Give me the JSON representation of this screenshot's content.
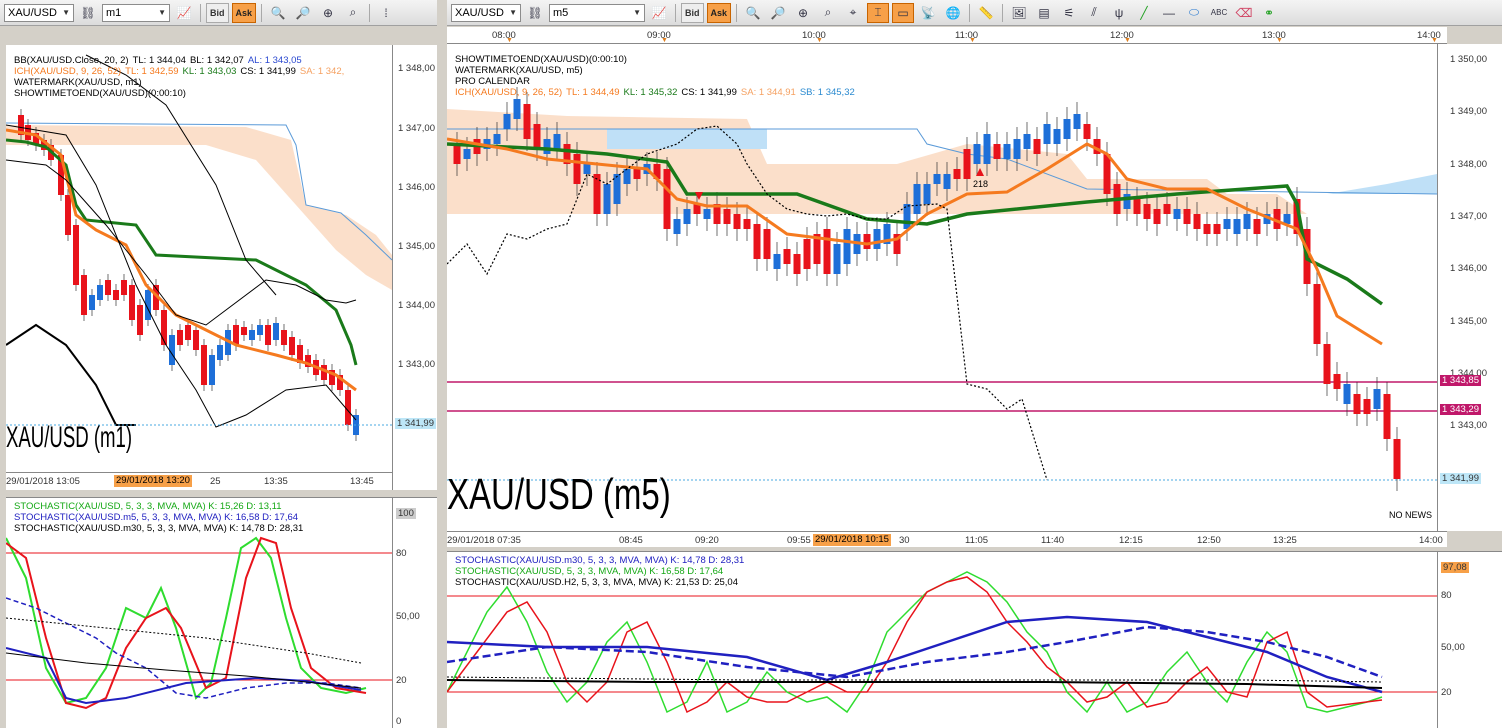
{
  "left": {
    "toolbar": {
      "symbol": "XAU/USD",
      "timeframe": "m1",
      "bid": "Bid",
      "ask": "Ask"
    },
    "legend": [
      {
        "parts": [
          [
            "BB(XAU/USD.Close, 20, 2)",
            "#000"
          ],
          [
            "TL: 1 344,04",
            "#000"
          ],
          [
            "BL: 1 342,07",
            "#000"
          ],
          [
            "AL: 1 343,05",
            "#2a48d0"
          ]
        ]
      },
      {
        "parts": [
          [
            "ICH(XAU/USD, 9, 26, 52)",
            "#f57a1f"
          ],
          [
            "TL: 1 342,59",
            "#f57a1f"
          ],
          [
            "KL: 1 343,03",
            "#1a7a1a"
          ],
          [
            "CS: 1 341,99",
            "#000"
          ],
          [
            "SA: 1 342,",
            "#f5a060"
          ]
        ]
      },
      {
        "parts": [
          [
            "WATERMARK(XAU/USD, m1)",
            "#000"
          ]
        ]
      },
      {
        "parts": [
          [
            "SHOWTIMETOEND(XAU/USD)(0:00:10)",
            "#000"
          ]
        ]
      }
    ],
    "price_ticks": [
      "1 348,00",
      "1 347,00",
      "1 346,00",
      "1 345,00",
      "1 344,00",
      "1 343,00",
      "1 342,00"
    ],
    "current_price": "1 341,99",
    "watermark": "XAU/USD (m1)",
    "time_labels": [
      "29/01/2018 13:05",
      "25",
      "13:35",
      "13:45"
    ],
    "time_highlight": "29/01/2018 13:20",
    "stoch_legend": [
      [
        "STOCHASTIC(XAU/USD, 5, 3, 3, MVA, MVA)  K: 15,26  D: 13,11",
        "#15a815"
      ],
      [
        "STOCHASTIC(XAU/USD.m5, 5, 3, 3, MVA, MVA)  K: 16,58  D: 17,64",
        "#2020c0"
      ],
      [
        "STOCHASTIC(XAU/USD.m30, 5, 3, 3, MVA, MVA)  K: 14,78  D: 28,31",
        "#000"
      ]
    ],
    "stoch_ticks": [
      "100",
      "80",
      "50,00",
      "20",
      "0"
    ]
  },
  "right": {
    "toolbar": {
      "symbol": "XAU/USD",
      "timeframe": "m5",
      "bid": "Bid",
      "ask": "Ask"
    },
    "top_times": [
      "08:00",
      "09:00",
      "10:00",
      "11:00",
      "12:00",
      "13:00",
      "14:00"
    ],
    "legend": [
      {
        "parts": [
          [
            "SHOWTIMETOEND(XAU/USD)(0:00:10)",
            "#000"
          ]
        ]
      },
      {
        "parts": [
          [
            "WATERMARK(XAU/USD, m5)",
            "#000"
          ]
        ]
      },
      {
        "parts": [
          [
            "PRO CALENDAR",
            "#000"
          ]
        ]
      },
      {
        "parts": [
          [
            "ICH(XAU/USD, 9, 26, 52)",
            "#f57a1f"
          ],
          [
            "TL: 1 344,49",
            "#f57a1f"
          ],
          [
            "KL: 1 345,32",
            "#1a7a1a"
          ],
          [
            "CS: 1 341,99",
            "#000"
          ],
          [
            "SA: 1 344,91",
            "#f5a060"
          ],
          [
            "SB: 1 345,32",
            "#2a8ad0"
          ]
        ]
      }
    ],
    "price_ticks": [
      "1 350,00",
      "1 349,00",
      "1 348,00",
      "1 347,00",
      "1 346,00",
      "1 345,00",
      "1 344,00",
      "1 343,00"
    ],
    "marker_prices": [
      "1 343,85",
      "1 343,29"
    ],
    "current_price": "1 341,99",
    "watermark": "XAU/USD (m5)",
    "no_news": "NO NEWS",
    "event_label": "218",
    "time_labels": [
      "29/01/2018 07:35",
      "08:45",
      "09:20",
      "09:55",
      "30",
      "11:05",
      "11:40",
      "12:15",
      "12:50",
      "13:25",
      "14:00"
    ],
    "time_highlight": "29/01/2018 10:15",
    "stoch_legend": [
      [
        "STOCHASTIC(XAU/USD.m30, 5, 3, 3, MVA, MVA)  K: 14,78  D: 28,31",
        "#2020c0"
      ],
      [
        "STOCHASTIC(XAU/USD, 5, 3, 3, MVA, MVA)  K: 16,58  D: 17,64",
        "#15a815"
      ],
      [
        "STOCHASTIC(XAU/USD.H2, 5, 3, 3, MVA, MVA)  K: 21,53  D: 25,04",
        "#000"
      ]
    ],
    "stoch_ticks": [
      "97,08",
      "80",
      "50,00",
      "20"
    ]
  }
}
